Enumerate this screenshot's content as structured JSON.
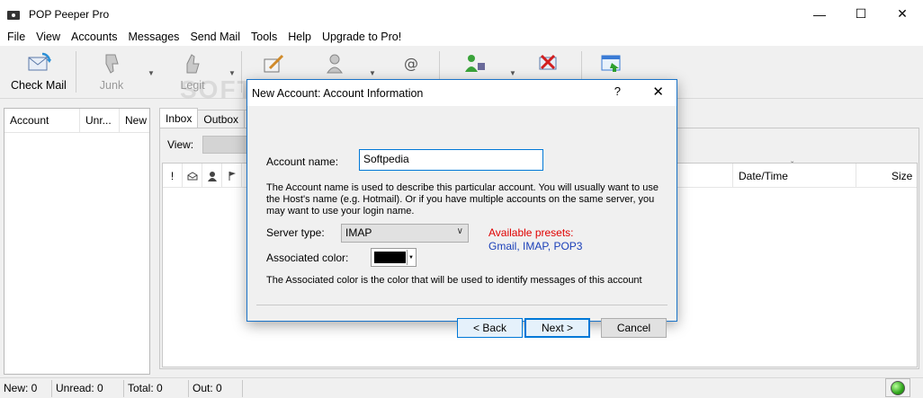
{
  "window": {
    "title": "POP Peeper Pro",
    "controls": [
      "—",
      "☐",
      "✕"
    ]
  },
  "menu": [
    "File",
    "View",
    "Accounts",
    "Messages",
    "Send Mail",
    "Tools",
    "Help",
    "Upgrade to Pro!"
  ],
  "toolbar": {
    "check_mail": "Check Mail",
    "junk": "Junk",
    "legit": "Legit"
  },
  "watermark": "SOFTPEDIA",
  "accounts_pane": {
    "columns": [
      "Account",
      "Unr...",
      "New"
    ]
  },
  "tabs": [
    "Inbox",
    "Outbox"
  ],
  "view_label": "View:",
  "message_list": {
    "columns": [
      "!",
      "Date/Time",
      "Size"
    ]
  },
  "status": {
    "new": "New: 0",
    "unread": "Unread: 0",
    "total": "Total: 0",
    "out": "Out: 0",
    "indicator_color": "#2fa51b"
  },
  "dialog": {
    "title": "New Account: Account Information",
    "help": "?",
    "close": "✕",
    "account_name_label": "Account name:",
    "account_name_value": "Softpedia",
    "description": "The Account name is used to describe this particular account.  You will usually want to use the Host's name (e.g. Hotmail).  Or if you have multiple accounts on the same server, you may want to use your login name.",
    "server_type_label": "Server type:",
    "server_type_value": "IMAP",
    "presets_title": "Available presets:",
    "presets_list": "Gmail, IMAP, POP3",
    "assoc_color_label": "Associated color:",
    "assoc_color_value": "#000000",
    "assoc_color_note": "The Associated color is the color that will be used to identify messages of this account",
    "back_label": "< Back",
    "next_label": "Next >",
    "cancel_label": "Cancel"
  }
}
